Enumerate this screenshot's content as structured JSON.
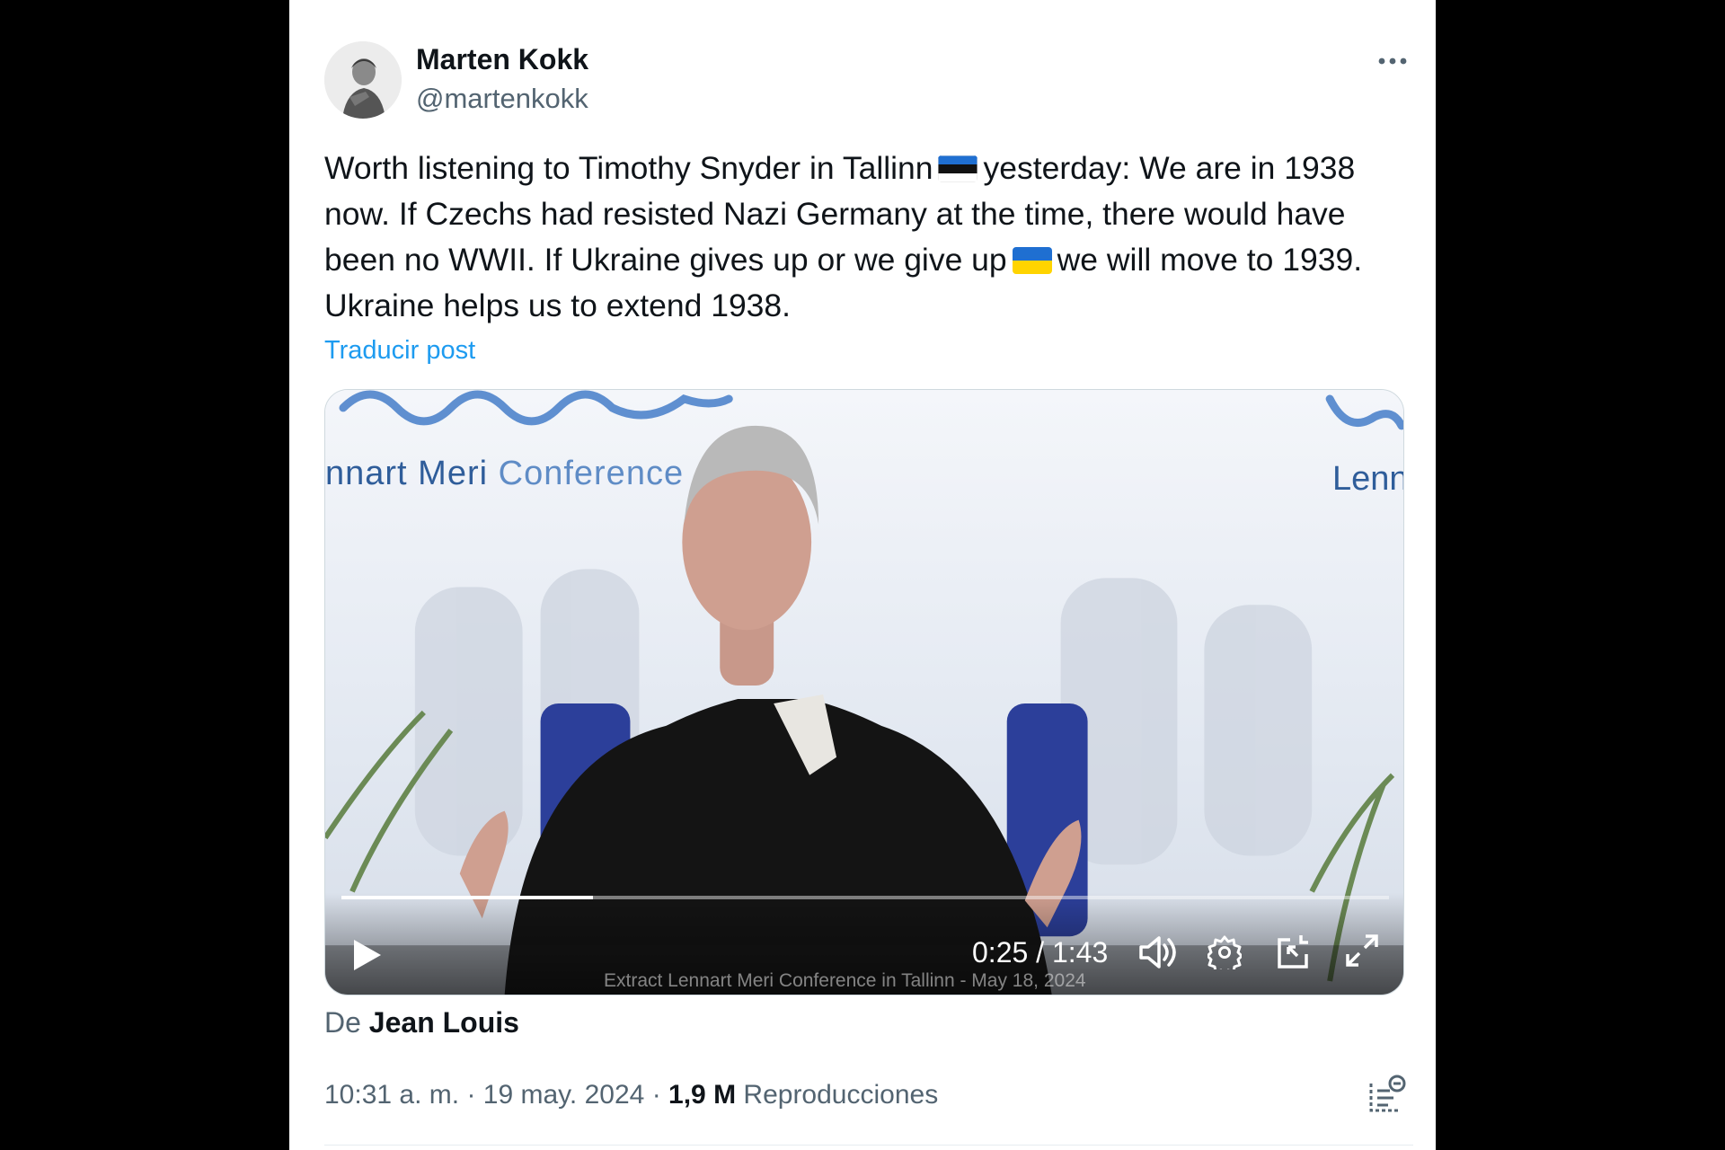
{
  "author": {
    "display_name": "Marten Kokk",
    "handle": "@martenkokk"
  },
  "tweet": {
    "text_part1": "Worth listening to Timothy Snyder in Tallinn",
    "text_part2": "yesterday: We are in 1938 now. If Czechs had resisted Nazi Germany at the time, there would have been no WWII. If Ukraine gives up or we give up",
    "text_part3": "we will move to 1939. Ukraine helps us to extend 1938.",
    "flag1": "estonia-flag",
    "flag2": "ukraine-flag",
    "translate_label": "Traducir post"
  },
  "video": {
    "banner_left_a": "nnart Meri",
    "banner_left_b": "Conference",
    "banner_right": "Lenn",
    "time": "0:25 / 1:43",
    "progress": 0.24,
    "caption": "Extract Lennart Meri Conference in Tallinn - May 18, 2024"
  },
  "attribution": {
    "prefix": "De",
    "name": "Jean Louis"
  },
  "meta": {
    "time": "10:31 a. m.",
    "sep1": "·",
    "date": "19 may. 2024",
    "sep2": "·",
    "views_count": "1,9 M",
    "views_label": "Reproducciones"
  },
  "colors": {
    "link": "#1d9bf0",
    "text": "#0f1419",
    "muted": "#536471"
  }
}
